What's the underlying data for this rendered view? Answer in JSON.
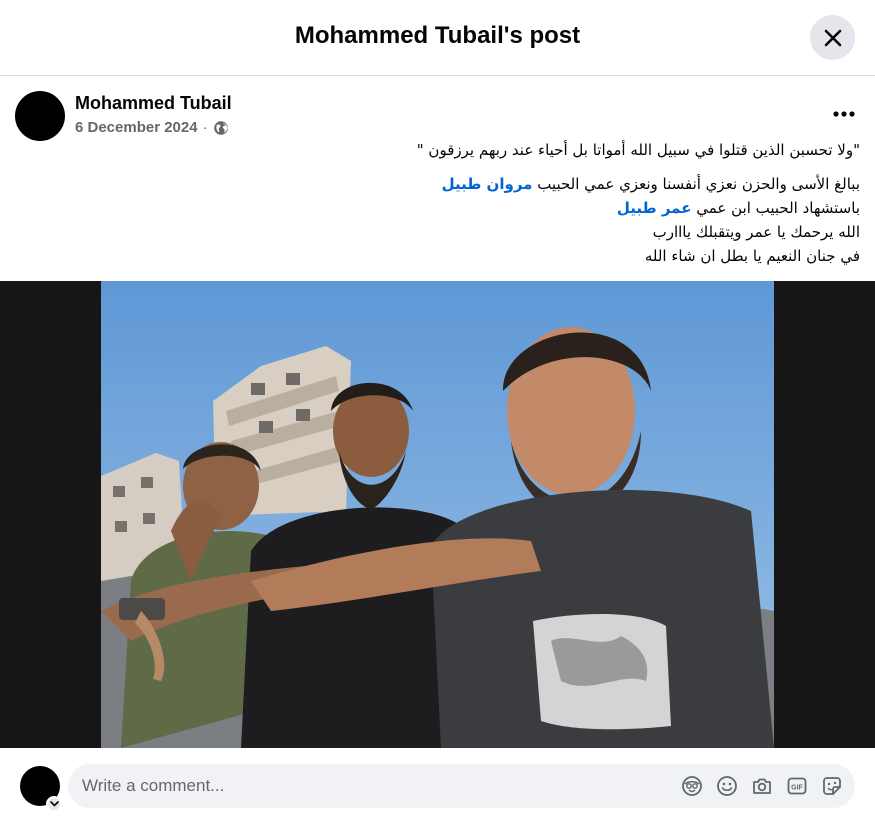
{
  "header": {
    "title": "Mohammed Tubail's post"
  },
  "post": {
    "author": "Mohammed Tubail",
    "date": "6 December 2024",
    "separator": "·",
    "audience_icon": "globe-icon",
    "more_icon": "more-horizontal-icon",
    "quote": "\"ولا تحسبن الذين قتلوا في سبيل الله أمواتا بل أحياء عند ربهم يرزقون \"",
    "line2_text": "ببالغ الأسى والحزن نعزي أنفسنا ونعزي عمي  الحبيب ",
    "line2_mention": "مروان طبيل",
    "line3_text": "باستشهاد  الحبيب ابن عمي ",
    "line3_mention": "عمر طبيل",
    "line4": "الله يرحمك يا عمر ويتقبلك يااارب",
    "line5": "في جنان النعيم يا بطل ان شاء الله"
  },
  "comment_box": {
    "placeholder": "Write a comment...",
    "tools": [
      "avatar-sticker-icon",
      "emoji-icon",
      "camera-icon",
      "gif-icon",
      "sticker-icon"
    ]
  },
  "colors": {
    "link": "#0064d1",
    "secondary_text": "#65676b",
    "button_bg": "#e4e6eb",
    "input_bg": "#f0f2f5",
    "photo_backdrop": "#161616"
  }
}
